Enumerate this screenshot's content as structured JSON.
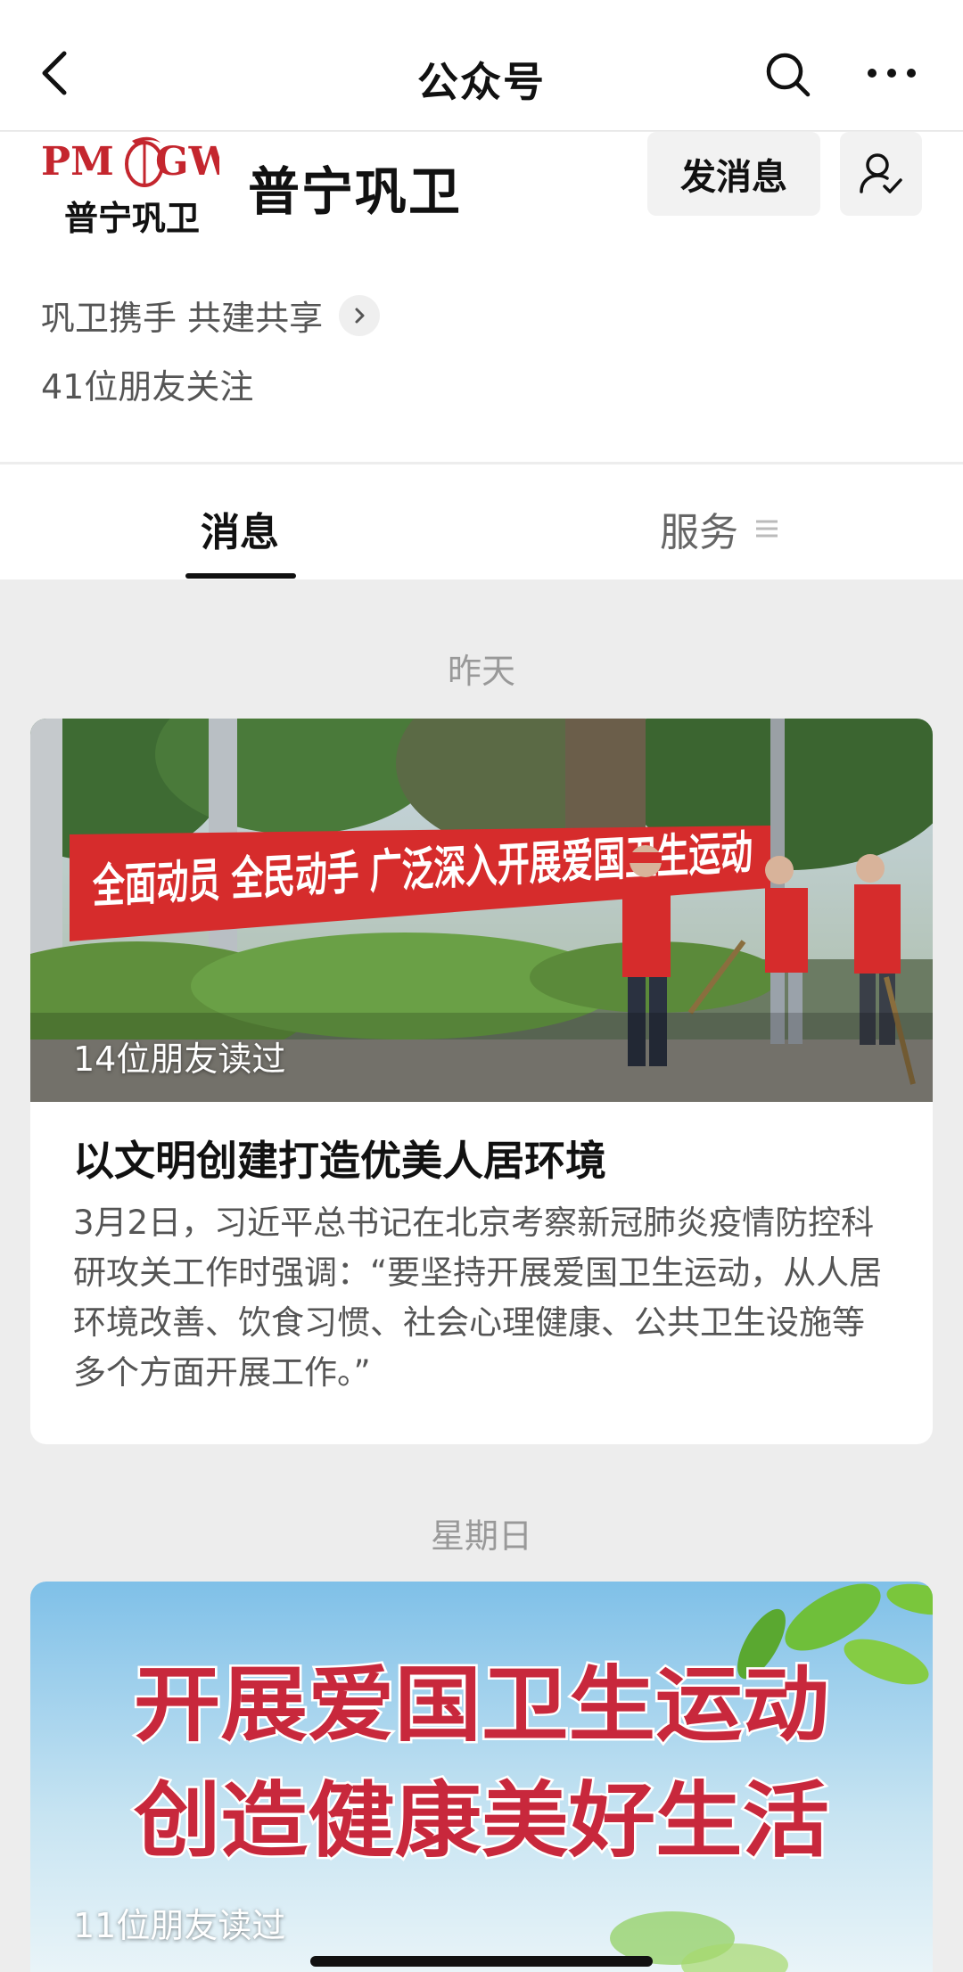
{
  "nav": {
    "title": "公众号",
    "back_icon": "chevron-left-icon",
    "search_icon": "search-icon",
    "more_icon": "ellipsis-icon"
  },
  "profile": {
    "logo_text": "PMGW",
    "logo_subtext": "普宁巩卫",
    "name": "普宁巩卫",
    "send_message_label": "发消息",
    "slogan": "巩卫携手 共建共享",
    "followers": "41位朋友关注"
  },
  "tabs": {
    "messages": "消息",
    "services": "服务"
  },
  "feed": [
    {
      "date": "昨天",
      "banner_text": "全面动员 全民动手 广泛深入开展爱国卫生运动",
      "read_count": "14位朋友读过",
      "title": "以文明创建打造优美人居环境",
      "summary": "3月2日，习近平总书记在北京考察新冠肺炎疫情防控科研攻关工作时强调：“要坚持开展爱国卫生运动，从人居环境改善、饮食习惯、社会心理健康、公共卫生设施等多个方面开展工作。”"
    },
    {
      "date": "星期日",
      "poster_line1": "开展爱国卫生运动",
      "poster_line2": "创造健康美好生活",
      "read_count": "11位朋友读过"
    }
  ],
  "colors": {
    "accent_red": "#d62c2c",
    "background": "#ededed",
    "poster_text_red": "#c8283c"
  }
}
